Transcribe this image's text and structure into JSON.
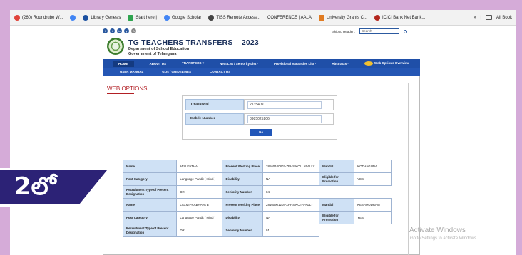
{
  "bookmarks": [
    {
      "label": "(260) Roundrube W...",
      "color": "#e0433a"
    },
    {
      "label": "",
      "color": "#4285f4"
    },
    {
      "label": "Library Genesis",
      "color": "#1a4fa0"
    },
    {
      "label": "Start here |",
      "color": "#2ea44f"
    },
    {
      "label": "Google Scholar",
      "color": "#4285f4"
    },
    {
      "label": "TISS Remote Access...",
      "color": "#444444"
    },
    {
      "label": "CONFERENCE | AALA",
      "color": "#ffffff"
    },
    {
      "label": "University Grants C...",
      "color": "#e07b22"
    },
    {
      "label": "ICICI Bank Net Bank...",
      "color": "#b3261e"
    }
  ],
  "bookmarks_overflow": "»",
  "all_bookmarks": "All Book",
  "toolbar": {
    "skip_header": "Skip to Header :",
    "search_placeholder": "Search",
    "icons": [
      "f",
      "t",
      "in",
      "y",
      "A"
    ]
  },
  "header": {
    "title": "TG TEACHERS TRANSFERS – 2023",
    "subtitle1": "Department of School Education",
    "subtitle2": "Government of Telangana"
  },
  "nav_primary": [
    "HOME",
    "ABOUT US",
    "TRANSFERS ▾",
    "Next List / Seniority List ·",
    "Provisional Vacancies List ·",
    "Abstracts ·",
    "Web Options Overview ·"
  ],
  "nav_secondary": [
    "USER MANUAL",
    "GOs / GUIDELINES",
    "CONTACT US"
  ],
  "page_title": "WEB OPTIONS",
  "form": {
    "treasury_label": "Treasury Id",
    "treasury_value": "2135409",
    "mobile_label": "Mobile Number",
    "mobile_value": "8985025206",
    "go_label": "Go"
  },
  "table_rows": [
    [
      "Name",
      "M SUJATHA",
      "Present Working Place",
      "28160100802-ZPHS KOLLAPALLY",
      "Mandal",
      "KOTHAGUDA"
    ],
    [
      "Post Category",
      "Language Pandit ( Hindi )",
      "Disability",
      "NA",
      "Eligible for Promotion",
      "YES"
    ],
    [
      "Recruitment Type of Present Designation",
      "DR",
      "Seniority Number",
      "84",
      "",
      ""
    ],
    [
      "Name",
      "LAXMIPRABHAVA B",
      "Present Working Place",
      "28160901204-ZPHS KOTAPALLY",
      "Mandal",
      "KESAMUDRAM"
    ],
    [
      "Post Category",
      "Language Pandit ( Hindi )",
      "Disability",
      "NA",
      "Eligible for Promotion",
      "YES"
    ],
    [
      "Recruitment Type of Present Designation",
      "DR",
      "Seniority Number",
      "91",
      "",
      ""
    ]
  ],
  "watermark": {
    "title": "Activate Windows",
    "subtitle": "Go to Settings to activate Windows."
  },
  "badge": "2లో"
}
